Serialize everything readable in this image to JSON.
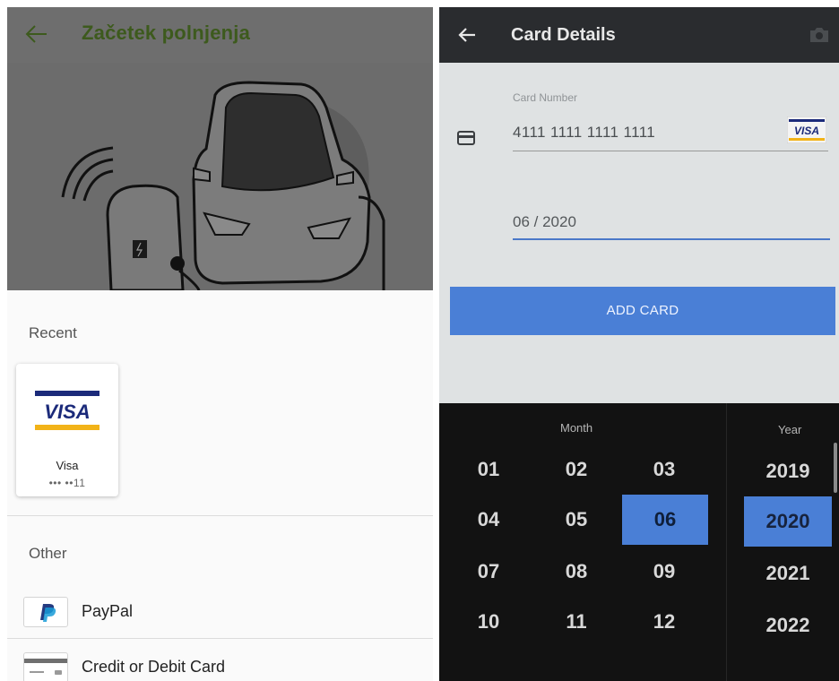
{
  "left": {
    "header": {
      "title": "Začetek polnjenja"
    },
    "recent": {
      "label": "Recent",
      "card": {
        "name": "Visa",
        "masked": "••• ••11",
        "logo_text": "VISA"
      }
    },
    "other": {
      "label": "Other",
      "items": [
        {
          "label": "PayPal",
          "icon": "paypal-icon"
        },
        {
          "label": "Credit or Debit Card",
          "icon": "credit-card-icon"
        }
      ]
    },
    "colors": {
      "title": "#3d5a1d",
      "overlay": "#6c6c6c"
    }
  },
  "right": {
    "header": {
      "title": "Card Details"
    },
    "form": {
      "card_number_label": "Card Number",
      "card_number_value": "4111 1111 1111 1111",
      "badge_text": "VISA",
      "expiry_value": "06 / 2020",
      "add_button": "ADD CARD"
    },
    "picker": {
      "month_label": "Month",
      "year_label": "Year",
      "months": [
        "01",
        "02",
        "03",
        "04",
        "05",
        "06",
        "07",
        "08",
        "09",
        "10",
        "11",
        "12"
      ],
      "years": [
        "2019",
        "2020",
        "2021",
        "2022"
      ],
      "selected_month": "06",
      "selected_year": "2020"
    },
    "colors": {
      "accent": "#4a7fd6"
    }
  }
}
